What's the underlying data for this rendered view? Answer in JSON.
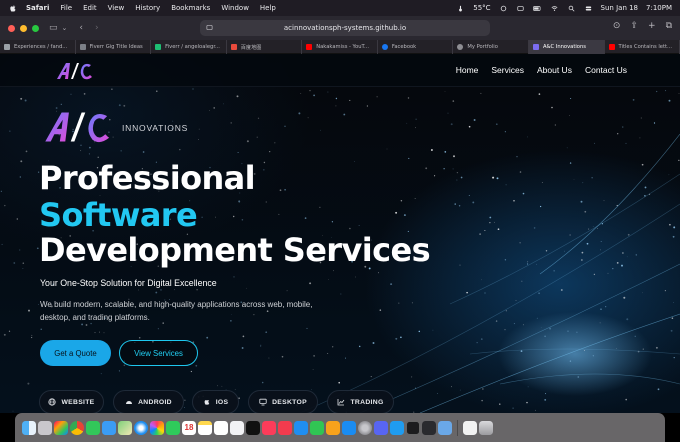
{
  "menubar": {
    "items": [
      "Safari",
      "File",
      "Edit",
      "View",
      "History",
      "Bookmarks",
      "Window",
      "Help"
    ],
    "temperature": "55°C",
    "date": "Sun Jan 18",
    "time": "7:10PM"
  },
  "browser": {
    "url": "acinnovationsph-systems.github.io",
    "tabs": [
      {
        "title": "Experiences / fand...",
        "color": "#9aa0a6"
      },
      {
        "title": "Fiverr Gig Title Ideas",
        "color": "#7c8087"
      },
      {
        "title": "Fiverr / angeloalegr...",
        "color": "#1dbf73"
      },
      {
        "title": "百度地图",
        "color": "#e84a3c"
      },
      {
        "title": "Nakakamiss - YouT...",
        "color": "#ff0000"
      },
      {
        "title": "Facebook",
        "color": "#1877f2"
      },
      {
        "title": "My Portfolio",
        "color": "#8e8e93"
      },
      {
        "title": "A&C Innovations",
        "color": "#7b6cf0"
      },
      {
        "title": "Titles Contains lett...",
        "color": "#ff0000"
      }
    ],
    "active_tab": 7
  },
  "site": {
    "logo_text": "A/C",
    "brand": "INNOVATIONS",
    "nav": [
      "Home",
      "Services",
      "About Us",
      "Contact Us"
    ],
    "headline": [
      "Professional",
      "Software",
      "Development Services"
    ],
    "tagline": "Your One-Stop Solution for Digital Excellence",
    "description": "We build modern, scalable, and high-quality applications across web, mobile, desktop, and trading platforms.",
    "cta_primary": "Get a Quote",
    "cta_secondary": "View Services",
    "platforms": [
      "WEBSITE",
      "ANDROID",
      "IOS",
      "DESKTOP",
      "TRADING"
    ],
    "accent": "#22c8f2",
    "button_color": "#1aa7e8"
  },
  "dock": {
    "calendar_day": "18",
    "apps": [
      "finder-icon",
      "launchpad-icon",
      "apps-icon",
      "chrome-icon",
      "messages-icon",
      "mail-icon",
      "maps-icon",
      "safari-icon",
      "photos-icon",
      "facetime-icon",
      "calendar-icon",
      "notes-icon",
      "reminders-icon",
      "freeform-icon",
      "tv-icon",
      "music-icon",
      "news-icon",
      "keynote-icon",
      "numbers-icon",
      "pages-icon",
      "appstore-icon",
      "settings-icon",
      "discord-icon",
      "vscode-icon",
      "terminal-icon",
      "stickies-icon",
      "preview-icon",
      "document-icon",
      "trash-icon"
    ]
  }
}
